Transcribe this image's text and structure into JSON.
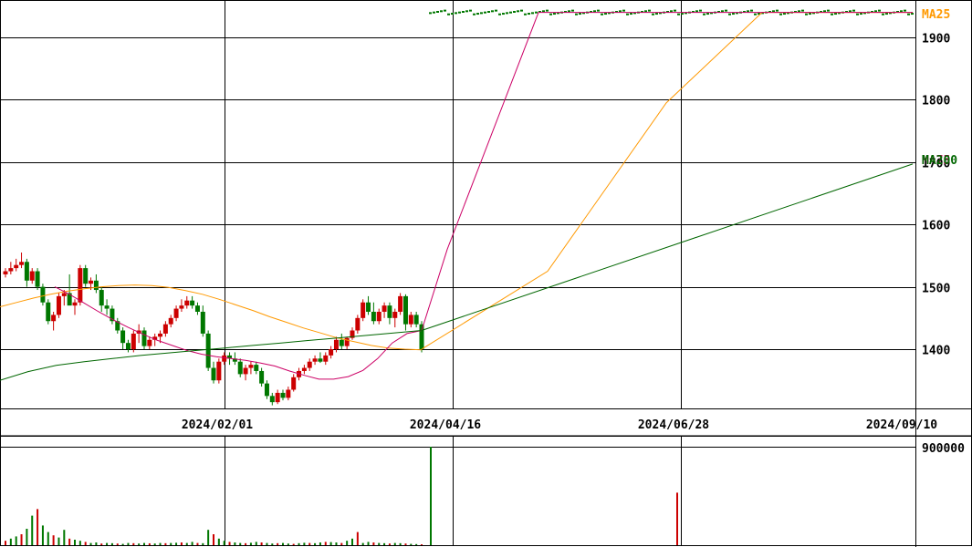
{
  "chart_data": [
    {
      "type": "candlestick",
      "y_ticks": [
        "1900",
        "1800",
        "1700",
        "1600",
        "1500",
        "1400"
      ],
      "y_tick_values": [
        1900,
        1800,
        1700,
        1600,
        1500,
        1400
      ],
      "ylim": [
        1305,
        1960
      ],
      "x_ticks": [
        "2024/02/01",
        "2024/04/16",
        "2024/06/28",
        "2024/09/10"
      ],
      "ma_labels": [
        {
          "text": "MA25",
          "color": "#ff9900"
        },
        {
          "text": "MA75",
          "color": "#cc0066"
        },
        {
          "text": "MA200",
          "color": "#006600"
        }
      ],
      "colors": {
        "up": "#cc0000",
        "down": "#007700",
        "grid": "#000000"
      },
      "candles_ohlc": [
        [
          1520,
          1530,
          1515,
          1525
        ],
        [
          1525,
          1540,
          1520,
          1530
        ],
        [
          1530,
          1545,
          1525,
          1535
        ],
        [
          1535,
          1555,
          1530,
          1540
        ],
        [
          1540,
          1545,
          1500,
          1510
        ],
        [
          1510,
          1530,
          1505,
          1525
        ],
        [
          1525,
          1530,
          1495,
          1500
        ],
        [
          1500,
          1505,
          1470,
          1475
        ],
        [
          1475,
          1480,
          1440,
          1445
        ],
        [
          1445,
          1460,
          1430,
          1455
        ],
        [
          1455,
          1490,
          1450,
          1485
        ],
        [
          1485,
          1495,
          1470,
          1490
        ],
        [
          1490,
          1520,
          1480,
          1470
        ],
        [
          1470,
          1480,
          1455,
          1475
        ],
        [
          1475,
          1535,
          1470,
          1530
        ],
        [
          1530,
          1535,
          1500,
          1505
        ],
        [
          1505,
          1515,
          1495,
          1510
        ],
        [
          1510,
          1520,
          1490,
          1495
        ],
        [
          1495,
          1500,
          1460,
          1470
        ],
        [
          1470,
          1480,
          1455,
          1465
        ],
        [
          1465,
          1470,
          1440,
          1445
        ],
        [
          1445,
          1450,
          1425,
          1430
        ],
        [
          1430,
          1435,
          1400,
          1410
        ],
        [
          1410,
          1415,
          1395,
          1400
        ],
        [
          1400,
          1430,
          1395,
          1425
        ],
        [
          1425,
          1440,
          1410,
          1430
        ],
        [
          1430,
          1435,
          1400,
          1405
        ],
        [
          1405,
          1420,
          1400,
          1415
        ],
        [
          1415,
          1425,
          1405,
          1420
        ],
        [
          1420,
          1430,
          1410,
          1425
        ],
        [
          1425,
          1445,
          1420,
          1440
        ],
        [
          1440,
          1455,
          1435,
          1450
        ],
        [
          1450,
          1470,
          1445,
          1465
        ],
        [
          1465,
          1480,
          1460,
          1470
        ],
        [
          1470,
          1485,
          1465,
          1478
        ],
        [
          1478,
          1485,
          1465,
          1470
        ],
        [
          1470,
          1475,
          1455,
          1460
        ],
        [
          1460,
          1470,
          1420,
          1425
        ],
        [
          1425,
          1430,
          1365,
          1370
        ],
        [
          1370,
          1380,
          1345,
          1350
        ],
        [
          1350,
          1385,
          1345,
          1380
        ],
        [
          1380,
          1395,
          1375,
          1390
        ],
        [
          1390,
          1395,
          1375,
          1385
        ],
        [
          1385,
          1395,
          1375,
          1380
        ],
        [
          1380,
          1385,
          1355,
          1360
        ],
        [
          1360,
          1375,
          1350,
          1370
        ],
        [
          1370,
          1380,
          1360,
          1375
        ],
        [
          1375,
          1380,
          1360,
          1365
        ],
        [
          1365,
          1370,
          1340,
          1345
        ],
        [
          1345,
          1350,
          1320,
          1325
        ],
        [
          1325,
          1330,
          1310,
          1315
        ],
        [
          1315,
          1335,
          1312,
          1330
        ],
        [
          1330,
          1335,
          1318,
          1322
        ],
        [
          1322,
          1340,
          1318,
          1335
        ],
        [
          1335,
          1360,
          1332,
          1355
        ],
        [
          1355,
          1370,
          1350,
          1365
        ],
        [
          1365,
          1375,
          1360,
          1370
        ],
        [
          1370,
          1385,
          1365,
          1380
        ],
        [
          1380,
          1390,
          1375,
          1385
        ],
        [
          1385,
          1395,
          1378,
          1380
        ],
        [
          1380,
          1395,
          1375,
          1390
        ],
        [
          1390,
          1405,
          1385,
          1400
        ],
        [
          1400,
          1420,
          1395,
          1415
        ],
        [
          1415,
          1425,
          1400,
          1405
        ],
        [
          1405,
          1420,
          1400,
          1418
        ],
        [
          1418,
          1435,
          1415,
          1430
        ],
        [
          1430,
          1455,
          1425,
          1450
        ],
        [
          1450,
          1480,
          1445,
          1475
        ],
        [
          1475,
          1485,
          1455,
          1460
        ],
        [
          1460,
          1475,
          1440,
          1445
        ],
        [
          1445,
          1465,
          1440,
          1460
        ],
        [
          1460,
          1475,
          1450,
          1470
        ],
        [
          1470,
          1475,
          1440,
          1450
        ],
        [
          1450,
          1465,
          1435,
          1460
        ],
        [
          1460,
          1490,
          1455,
          1485
        ],
        [
          1485,
          1488,
          1430,
          1440
        ],
        [
          1440,
          1460,
          1435,
          1455
        ],
        [
          1455,
          1460,
          1435,
          1440
        ],
        [
          1440,
          1445,
          1395,
          1400
        ]
      ],
      "ma25": [
        1468,
        1475,
        1482,
        1488,
        1493,
        1497,
        1500,
        1502,
        1503,
        1502,
        1499,
        1494,
        1488,
        1480,
        1471,
        1462,
        1452,
        1443,
        1434,
        1426,
        1418,
        1412,
        1406,
        1402,
        1400,
        1399
      ],
      "ma75": [
        1500,
        1488,
        1474,
        1460,
        1447,
        1435,
        1424,
        1414,
        1406,
        1398,
        1392,
        1388,
        1385,
        1382,
        1378,
        1373,
        1365,
        1358,
        1352,
        1352,
        1356,
        1366,
        1385,
        1410,
        1425,
        1430
      ],
      "ma200": [
        1350,
        1364,
        1374,
        1380,
        1385,
        1390,
        1394,
        1398,
        1402,
        1406,
        1410,
        1414,
        1418,
        1422,
        1426,
        1430
      ],
      "volume": {
        "ytick": "900000",
        "ymax": 900000,
        "values": [
          40000,
          60000,
          80000,
          100000,
          150000,
          270000,
          330000,
          180000,
          120000,
          90000,
          70000,
          140000,
          60000,
          50000,
          40000,
          30000,
          20000,
          25000,
          15000,
          20000,
          18000,
          15000,
          12000,
          20000,
          18000,
          15000,
          20000,
          17000,
          15000,
          20000,
          18000,
          20000,
          22000,
          25000,
          20000,
          30000,
          20000,
          18000,
          140000,
          100000,
          60000,
          40000,
          30000,
          25000,
          20000,
          18000,
          22000,
          30000,
          25000,
          20000,
          15000,
          18000,
          20000,
          15000,
          12000,
          18000,
          22000,
          20000,
          18000,
          25000,
          30000,
          28000,
          25000,
          20000,
          40000,
          60000,
          120000,
          20000,
          30000,
          25000,
          20000,
          18000,
          15000,
          20000,
          18000,
          15000,
          12000,
          10000,
          8000
        ]
      }
    }
  ]
}
